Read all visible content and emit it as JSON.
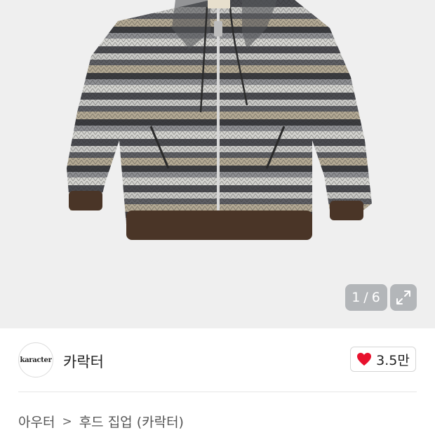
{
  "gallery": {
    "current": "1",
    "total": "6",
    "counter_separator": "/",
    "expand_icon": "expand-icon"
  },
  "brand": {
    "logo_text": "karacter",
    "name": "카락터"
  },
  "likes": {
    "count": "3.5만",
    "icon": "heart-icon",
    "color": "#e8112d"
  },
  "breadcrumb": {
    "items": [
      "아우터",
      "후드 집업 (카락터)"
    ],
    "separator": ">"
  }
}
